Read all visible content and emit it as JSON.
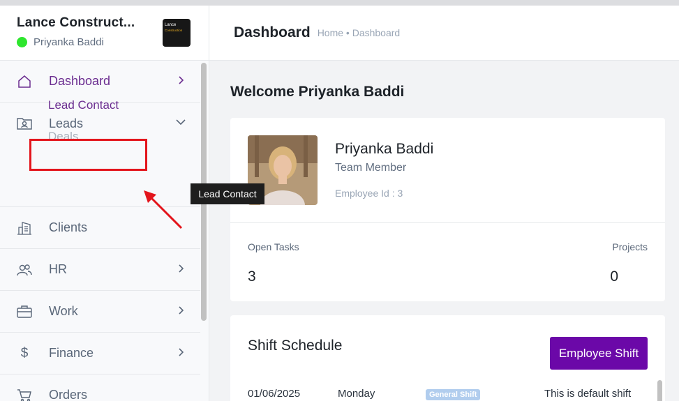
{
  "brand": {
    "name": "Lance Construct...",
    "user": "Priyanka Baddi",
    "logo_line1": "Lance",
    "logo_line2": "Construction",
    "status_color": "#2ee62e"
  },
  "sidebar": {
    "items": [
      {
        "label": "Dashboard",
        "icon": "home-icon"
      },
      {
        "label": "Leads",
        "icon": "leads-icon"
      },
      {
        "label": "Clients",
        "icon": "building-icon"
      },
      {
        "label": "HR",
        "icon": "users-icon"
      },
      {
        "label": "Work",
        "icon": "briefcase-icon"
      },
      {
        "label": "Finance",
        "icon": "dollar-icon"
      },
      {
        "label": "Orders",
        "icon": "cart-icon"
      }
    ],
    "leads_sub": {
      "lead_contact": "Lead Contact",
      "deals": "Deals"
    },
    "tooltip": "Lead Contact"
  },
  "header": {
    "title": "Dashboard",
    "breadcrumb": "Home • Dashboard"
  },
  "main": {
    "welcome": "Welcome Priyanka Baddi",
    "profile": {
      "name": "Priyanka Baddi",
      "role": "Team Member",
      "employee_id": "Employee Id : 3"
    },
    "stats": [
      {
        "label": "Open Tasks",
        "value": "3"
      },
      {
        "label": "Projects",
        "value": "0"
      }
    ],
    "shift": {
      "title": "Shift Schedule",
      "button": "Employee Shift",
      "row": {
        "date": "01/06/2025",
        "day": "Monday",
        "badge": "General Shift",
        "note": "This is default shift"
      }
    }
  },
  "colors": {
    "accent": "#6b2d90",
    "button": "#6b08a8",
    "highlight": "#e3151c"
  }
}
